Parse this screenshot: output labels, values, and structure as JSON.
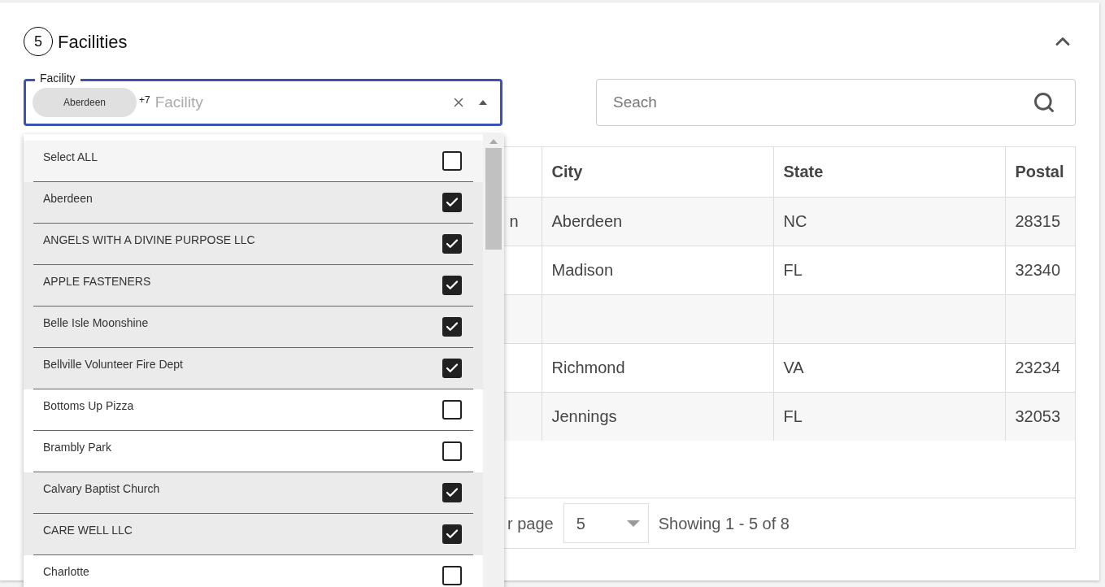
{
  "section": {
    "step": "5",
    "title": "Facilities",
    "expanded": true
  },
  "facility_field": {
    "label": "Facility",
    "chip": "Aberdeen",
    "more_count": "+7",
    "placeholder": "Facility",
    "open": true
  },
  "search": {
    "placeholder": "Seach"
  },
  "dropdown": {
    "items": [
      {
        "label": "Select ALL",
        "checked": false,
        "kind": "all"
      },
      {
        "label": "Aberdeen",
        "checked": true,
        "kind": "option"
      },
      {
        "label": "ANGELS WITH A DIVINE PURPOSE LLC",
        "checked": true,
        "kind": "option"
      },
      {
        "label": "APPLE FASTENERS",
        "checked": true,
        "kind": "option"
      },
      {
        "label": "Belle Isle Moonshine",
        "checked": true,
        "kind": "option"
      },
      {
        "label": "Bellville Volunteer Fire Dept",
        "checked": true,
        "kind": "option"
      },
      {
        "label": "Bottoms Up Pizza",
        "checked": false,
        "kind": "option"
      },
      {
        "label": "Brambly Park",
        "checked": false,
        "kind": "option"
      },
      {
        "label": "Calvary Baptist Church",
        "checked": true,
        "kind": "option"
      },
      {
        "label": "CARE WELL LLC",
        "checked": true,
        "kind": "option"
      },
      {
        "label": "Charlotte",
        "checked": false,
        "kind": "option"
      }
    ]
  },
  "table": {
    "columns": [
      "",
      "City",
      "State",
      "Postal"
    ],
    "rows": [
      [
        "n",
        "Aberdeen",
        "NC",
        "28315"
      ],
      [
        "",
        "Madison",
        "FL",
        "32340"
      ],
      [
        "",
        "",
        "",
        ""
      ],
      [
        "",
        "Richmond",
        "VA",
        "23234"
      ],
      [
        "",
        "Jennings",
        "FL",
        "32053"
      ]
    ]
  },
  "pagination": {
    "per_page_label": "r page",
    "per_page": "5",
    "summary": "Showing 1 - 5 of 8"
  }
}
